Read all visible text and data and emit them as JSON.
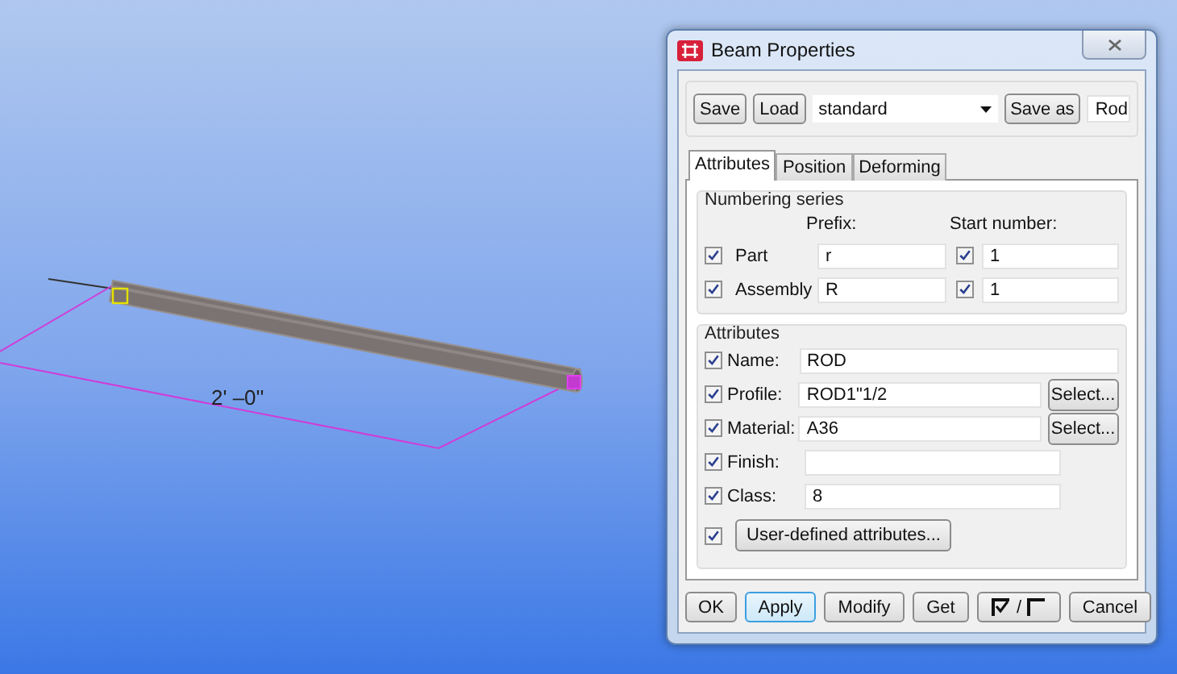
{
  "viewport": {
    "dimension": "2' –0''"
  },
  "window": {
    "title": "Beam Properties"
  },
  "toolbar": {
    "save": "Save",
    "load": "Load",
    "preset": "standard",
    "save_as": "Save as",
    "save_as_name": "Rod"
  },
  "tabs": [
    {
      "label": "Attributes",
      "selected": true
    },
    {
      "label": "Position",
      "selected": false
    },
    {
      "label": "Deforming",
      "selected": false
    }
  ],
  "numbering": {
    "title": "Numbering series",
    "prefix_header": "Prefix:",
    "start_header": "Start number:",
    "rows": [
      {
        "label": "Part",
        "checked": true,
        "prefix": "r",
        "start_checked": true,
        "start": "1"
      },
      {
        "label": "Assembly",
        "checked": true,
        "prefix": "R",
        "start_checked": true,
        "start": "1"
      }
    ]
  },
  "attributes": {
    "title": "Attributes",
    "fields": [
      {
        "label": "Name:",
        "checked": true,
        "value": "ROD",
        "kind": "wide"
      },
      {
        "label": "Profile:",
        "checked": true,
        "value": "ROD1\"1/2",
        "kind": "select",
        "button": "Select..."
      },
      {
        "label": "Material:",
        "checked": true,
        "value": "A36",
        "kind": "select",
        "button": "Select..."
      },
      {
        "label": "Finish:",
        "checked": true,
        "kind": "short"
      },
      {
        "label": "Class:",
        "checked": true,
        "value": "8",
        "kind": "short"
      }
    ],
    "user_defined": {
      "checked": true,
      "label": "User-defined attributes..."
    }
  },
  "buttons": [
    {
      "kind": "text",
      "label": "OK",
      "default": false
    },
    {
      "kind": "text",
      "label": "Apply",
      "default": true
    },
    {
      "kind": "text",
      "label": "Modify",
      "default": false
    },
    {
      "kind": "text",
      "label": "Get",
      "default": false
    },
    {
      "kind": "toggle",
      "label": "/",
      "default": false
    },
    {
      "kind": "text",
      "label": "Cancel",
      "default": false
    }
  ]
}
